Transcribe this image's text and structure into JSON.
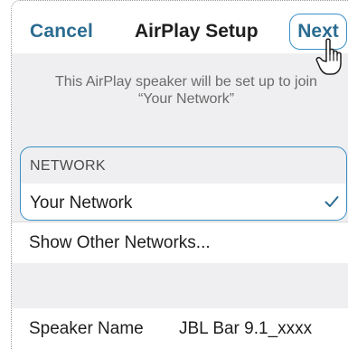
{
  "navbar": {
    "cancel_label": "Cancel",
    "title": "AirPlay Setup",
    "next_label": "Next"
  },
  "info": {
    "line1": "This AirPlay speaker will be set up to join",
    "line2": "“Your Network”"
  },
  "network_section": {
    "header": "NETWORK",
    "selected_network": "Your Network",
    "selected_icon": "checkmark-icon"
  },
  "other_networks": {
    "label": "Show Other Networks..."
  },
  "speaker": {
    "label": "Speaker Name",
    "value": "JBL Bar 9.1_xxxx"
  },
  "icons": {
    "pointer": "hand-pointer-icon"
  },
  "colors": {
    "accent": "#2b6c91",
    "highlight_border": "#3a8fc4",
    "group_background": "#efeff1"
  }
}
